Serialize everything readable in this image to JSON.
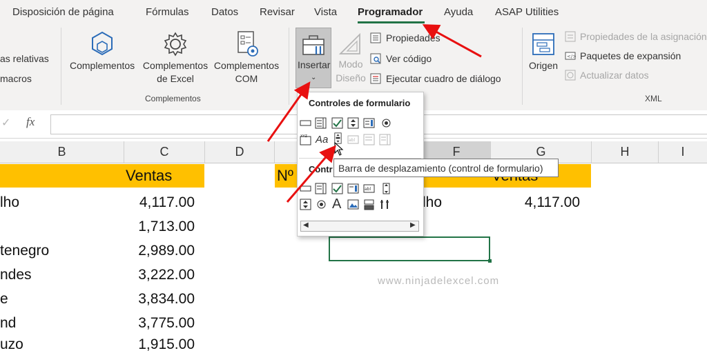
{
  "menu_tabs": [
    {
      "label": "Disposición de página",
      "active": false
    },
    {
      "label": "Fórmulas",
      "active": false
    },
    {
      "label": "Datos",
      "active": false
    },
    {
      "label": "Revisar",
      "active": false
    },
    {
      "label": "Vista",
      "active": false
    },
    {
      "label": "Programador",
      "active": true
    },
    {
      "label": "Ayuda",
      "active": false
    },
    {
      "label": "ASAP Utilities",
      "active": false
    }
  ],
  "ribbon": {
    "code_group": {
      "relative_refs_partial": "as relativas",
      "macros_partial": "macros"
    },
    "addins_group": {
      "label": "Complementos",
      "complementos": "Complementos",
      "excel_addins_line1": "Complementos",
      "excel_addins_line2": "de Excel",
      "com_addins_line1": "Complementos",
      "com_addins_line2": "COM"
    },
    "controls_group": {
      "insert_label": "Insertar",
      "design_mode_line1": "Modo",
      "design_mode_line2": "Diseño",
      "properties": "Propiedades",
      "view_code": "Ver código",
      "run_dialog": "Ejecutar cuadro de diálogo"
    },
    "xml_group": {
      "label": "XML",
      "source": "Origen",
      "map_properties": "Propiedades de la asignación",
      "expansion_packs": "Paquetes de expansión",
      "refresh_data": "Actualizar datos"
    }
  },
  "formula_bar": {
    "fx": "fx",
    "value": ""
  },
  "columns": [
    "B",
    "C",
    "D",
    "E",
    "F",
    "G",
    "H",
    "I"
  ],
  "sheet": {
    "header_c": "Ventas",
    "header_e_partial": "Nº",
    "header_g_partial": "Ventas",
    "rows": [
      {
        "b": "lho",
        "c": "4,117.00"
      },
      {
        "b": "",
        "c": "1,713.00"
      },
      {
        "b": "tenegro",
        "c": "2,989.00"
      },
      {
        "b": "ndes",
        "c": "3,222.00"
      },
      {
        "b": "e",
        "c": "3,834.00"
      },
      {
        "b": "nd",
        "c": "3,775.00"
      },
      {
        "b": "uzo",
        "c": "1,915.00"
      }
    ],
    "lookup_row": {
      "f_partial": "lho",
      "g": "4,117.00"
    }
  },
  "dropdown": {
    "form_controls_title": "Controles de formulario",
    "activex_title_partial": "Contr",
    "tooltip": "Barra de desplazamiento (control de formulario)"
  },
  "watermark": "www.ninjadelexcel.com",
  "colors": {
    "accent": "#217346",
    "header_fill": "#ffc000",
    "arrow": "#e81010"
  }
}
